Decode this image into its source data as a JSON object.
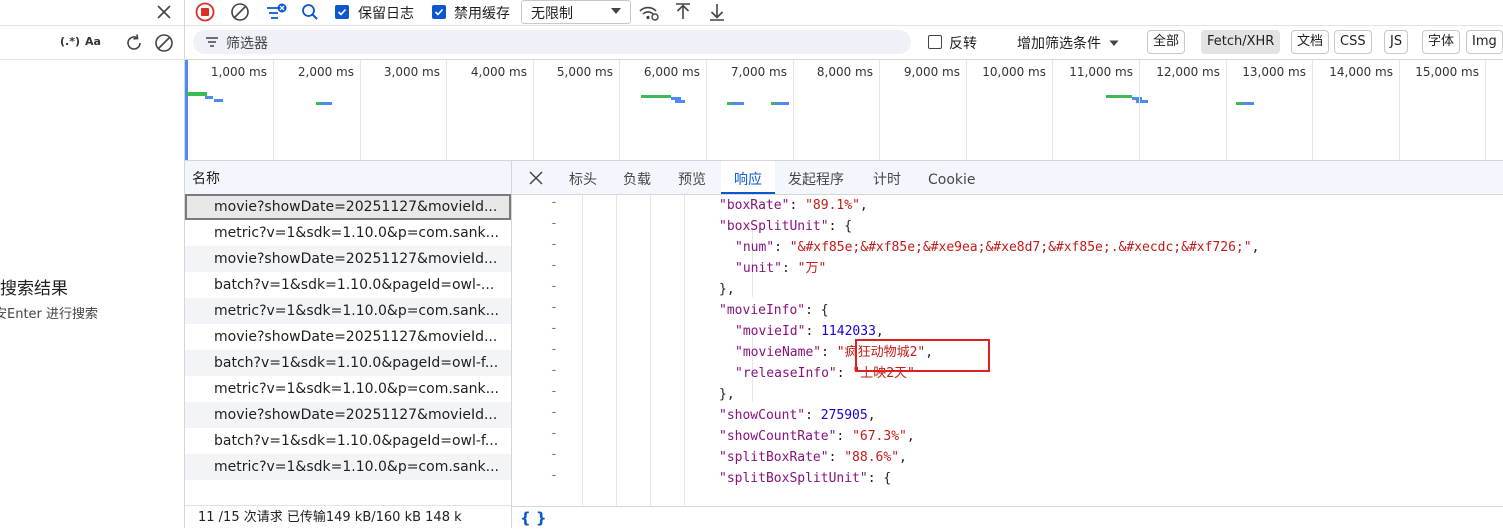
{
  "left_panel": {
    "regex_label": "(.*)",
    "case_label": "Aa",
    "empty_title_partial": "搜索结果",
    "empty_hint_partial": "安Enter 进行搜索"
  },
  "toolbar": {
    "preserve_log": "保留日志",
    "disable_cache": "禁用缓存",
    "throttle_value": "无限制"
  },
  "filterbar": {
    "placeholder": "筛选器",
    "invert_label": "反转",
    "more_filters": "增加筛选条件",
    "types": [
      "全部",
      "Fetch/XHR",
      "文档",
      "CSS",
      "JS",
      "字体",
      "Img"
    ],
    "active_type": "Fetch/XHR"
  },
  "overview": {
    "ticks": [
      "1,000 ms",
      "2,000 ms",
      "3,000 ms",
      "4,000 ms",
      "5,000 ms",
      "6,000 ms",
      "7,000 ms",
      "8,000 ms",
      "9,000 ms",
      "10,000 ms",
      "11,000 ms",
      "12,000 ms",
      "13,000 ms",
      "14,000 ms",
      "15,000 ms"
    ],
    "colors": {
      "green": "#3cba54",
      "blue": "#4c8bf5"
    }
  },
  "requests": {
    "header": "名称",
    "rows": [
      "movie?showDate=20251127&movieId...",
      "metric?v=1&sdk=1.10.0&p=com.sank...",
      "movie?showDate=20251127&movieId...",
      "batch?v=1&sdk=1.10.0&pageId=owl-...",
      "metric?v=1&sdk=1.10.0&p=com.sank...",
      "movie?showDate=20251127&movieId...",
      "batch?v=1&sdk=1.10.0&pageId=owl-f...",
      "metric?v=1&sdk=1.10.0&p=com.sank...",
      "movie?showDate=20251127&movieId...",
      "batch?v=1&sdk=1.10.0&pageId=owl-f...",
      "metric?v=1&sdk=1.10.0&p=com.sank..."
    ],
    "status": "11 /15 次请求    已传输149 kB/160 kB    148 k"
  },
  "detail_tabs": [
    "标头",
    "负载",
    "预览",
    "响应",
    "发起程序",
    "计时",
    "Cookie"
  ],
  "active_tab": "响应",
  "response_lines": [
    {
      "i": 4,
      "t": [
        [
          "k",
          "\"boxRate\""
        ],
        [
          "p",
          ": "
        ],
        [
          "s",
          "\"89.1%\""
        ],
        [
          "p",
          ","
        ]
      ]
    },
    {
      "i": 4,
      "t": [
        [
          "k",
          "\"boxSplitUnit\""
        ],
        [
          "p",
          ": {"
        ]
      ]
    },
    {
      "i": 6,
      "t": [
        [
          "k",
          "\"num\""
        ],
        [
          "p",
          ": "
        ],
        [
          "s",
          "\"&#xf85e;&#xf85e;&#xe9ea;&#xe8d7;&#xf85e;.&#xecdc;&#xf726;\""
        ],
        [
          "p",
          ","
        ]
      ]
    },
    {
      "i": 6,
      "t": [
        [
          "k",
          "\"unit\""
        ],
        [
          "p",
          ": "
        ],
        [
          "s",
          "\"万\""
        ]
      ]
    },
    {
      "i": 4,
      "t": [
        [
          "p",
          "},"
        ]
      ]
    },
    {
      "i": 4,
      "t": [
        [
          "k",
          "\"movieInfo\""
        ],
        [
          "p",
          ": {"
        ]
      ]
    },
    {
      "i": 6,
      "t": [
        [
          "k",
          "\"movieId\""
        ],
        [
          "p",
          ": "
        ],
        [
          "n",
          "1142033"
        ],
        [
          "p",
          ","
        ]
      ]
    },
    {
      "i": 6,
      "t": [
        [
          "k",
          "\"movieName\""
        ],
        [
          "p",
          ": "
        ],
        [
          "s",
          "\"疯狂动物城2\""
        ],
        [
          "p",
          ","
        ]
      ]
    },
    {
      "i": 6,
      "t": [
        [
          "k",
          "\"releaseInfo\""
        ],
        [
          "p",
          ": "
        ],
        [
          "s",
          "\"上映2天\""
        ]
      ]
    },
    {
      "i": 4,
      "t": [
        [
          "p",
          "},"
        ]
      ]
    },
    {
      "i": 4,
      "t": [
        [
          "k",
          "\"showCount\""
        ],
        [
          "p",
          ": "
        ],
        [
          "n",
          "275905"
        ],
        [
          "p",
          ","
        ]
      ]
    },
    {
      "i": 4,
      "t": [
        [
          "k",
          "\"showCountRate\""
        ],
        [
          "p",
          ": "
        ],
        [
          "s",
          "\"67.3%\""
        ],
        [
          "p",
          ","
        ]
      ]
    },
    {
      "i": 4,
      "t": [
        [
          "k",
          "\"splitBoxRate\""
        ],
        [
          "p",
          ": "
        ],
        [
          "s",
          "\"88.6%\""
        ],
        [
          "p",
          ","
        ]
      ]
    },
    {
      "i": 4,
      "t": [
        [
          "k",
          "\"splitBoxSplitUnit\""
        ],
        [
          "p",
          ": {"
        ]
      ]
    }
  ],
  "footer_symbol": "{ }"
}
